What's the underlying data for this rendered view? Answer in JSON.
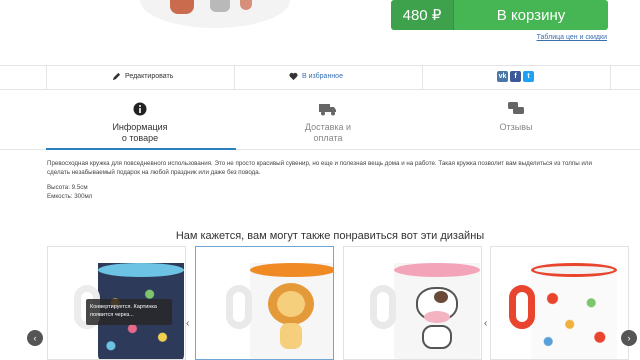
{
  "buy": {
    "price": "480 ₽",
    "cart_label": "В корзину",
    "price_table_link": "Таблица цен и скидки"
  },
  "actions": {
    "edit_label": "Редактировать",
    "favorite_label": "В избранное",
    "social": {
      "vk": "vk",
      "fb": "f",
      "tw": "t"
    }
  },
  "tabs": [
    {
      "label": "Информация\nо товаре",
      "icon": "info-icon",
      "active": true
    },
    {
      "label": "Доставка и\nоплата",
      "icon": "truck-icon",
      "active": false
    },
    {
      "label": "Отзывы",
      "icon": "chat-icon",
      "active": false
    }
  ],
  "description": {
    "text": "Превосходная кружка для повседневного использования. Это не просто красивый сувенир, но еще и полезная вещь дома и на работе. Такая кружка позволит вам выделиться из толпы или сделать незабываемый подарок на любой праздник или даже без повода.",
    "height": "Высота: 9.5см",
    "volume": "Емкость: 300мл"
  },
  "recommended": {
    "title": "Нам кажется, вам могут также понравиться вот эти дизайны",
    "tooltip": "Конвертируется. Картинка появится через..."
  },
  "colors": {
    "accent_green": "#46b553",
    "link_blue": "#3a6fb0",
    "tab_active": "#2a7fc1"
  }
}
